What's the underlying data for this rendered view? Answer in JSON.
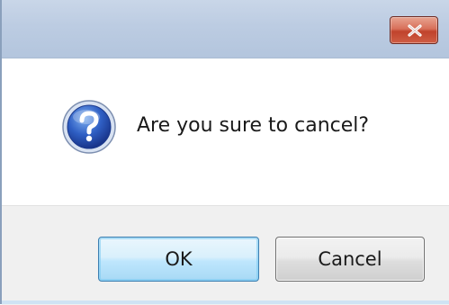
{
  "dialog": {
    "message": "Are you sure to cancel?",
    "icon": "question-icon",
    "close_icon": "close-x-icon"
  },
  "buttons": {
    "ok_label": "OK",
    "cancel_label": "Cancel"
  },
  "colors": {
    "titlebar": "#bccce2",
    "close_button": "#c9503a",
    "ok_focus_border": "#3c7fb1",
    "footer": "#f0f0f0"
  }
}
